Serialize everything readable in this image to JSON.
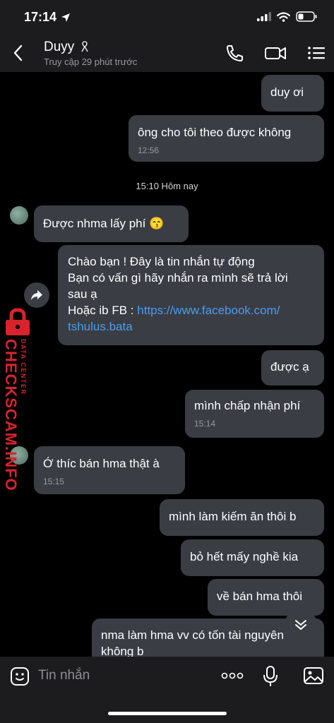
{
  "status_bar": {
    "time": "17:14"
  },
  "header": {
    "contact_name": "Duyy",
    "contact_status": "Truy cập 29 phút trước"
  },
  "watermark": {
    "brand": "CHECKSCAM.INFO",
    "tagline": "DATA CENTER"
  },
  "chat": {
    "day_separator": "15:10 Hôm nay",
    "messages": [
      {
        "text": "duy ơi",
        "time": ""
      },
      {
        "text": "ông cho tôi theo được không",
        "time": "12:56"
      },
      {
        "text": "Được nhma lấy phí 😙",
        "time": ""
      },
      {
        "text_lines": [
          "Chào bạn ! Đây là tin nhắn tự động",
          "Bạn có vấn gì hãy nhắn ra mình sẽ trả lời",
          "sau ạ",
          "Hoặc ib FB : "
        ],
        "link_part1": "https://www.facebook.com/",
        "link_part2": "tshulus.bata"
      },
      {
        "text": "được ạ",
        "time": ""
      },
      {
        "text": "mình chấp nhận phí",
        "time": "15:14"
      },
      {
        "text": "Ớ thíc bán hma thật à",
        "time": "15:15"
      },
      {
        "text": "mình làm kiếm ăn thôi b",
        "time": ""
      },
      {
        "text": "bỏ hết mấy nghề kia",
        "time": ""
      },
      {
        "text": "về bán hma thôi",
        "time": ""
      },
      {
        "text_line1": "nma làm hma vv có tốn tài nguyên",
        "text_line2": "không b"
      }
    ]
  },
  "input_bar": {
    "placeholder": "Tin nhắn",
    "more": "ooo"
  },
  "colors": {
    "bubble": "#3a3d44",
    "link": "#4a9cf0",
    "header_bg": "#1c1c1e",
    "watermark": "#d8232a"
  }
}
